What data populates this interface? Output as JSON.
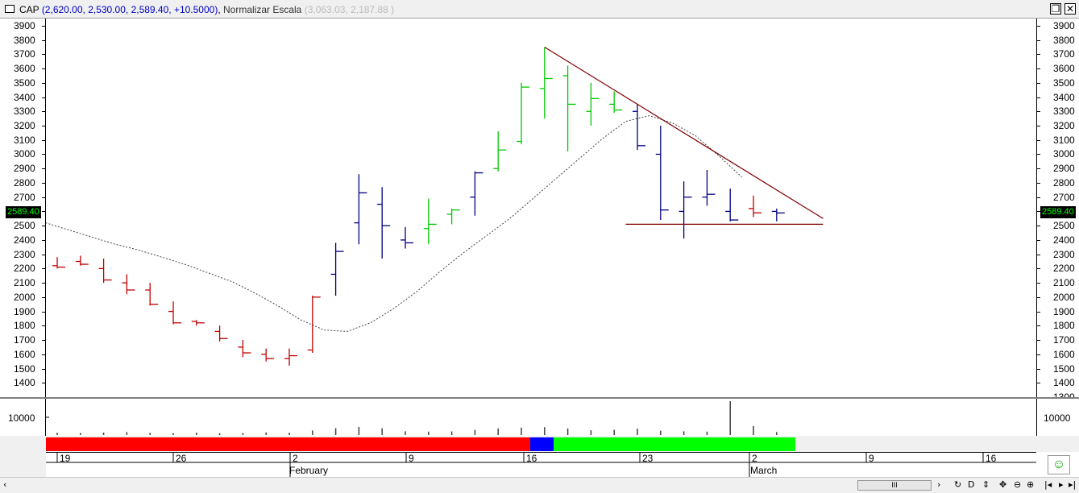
{
  "title": {
    "symbol": "CAP",
    "ohlc": "(2,620.00, 2,530.00, 2,589.40, +10.5000)",
    "normalize_label": "Normalizar Escala",
    "normalize_range": "(3,063.03, 2,187.88 )"
  },
  "window_buttons": {
    "restore": "❐",
    "close": "✕"
  },
  "price_axis": {
    "labels_left": [
      "3900",
      "3800",
      "3700",
      "3600",
      "3500",
      "3400",
      "3300",
      "3200",
      "3100",
      "3000",
      "2900",
      "2800",
      "2700",
      "2600",
      "2500",
      "2400",
      "2300",
      "2200",
      "2100",
      "2000",
      "1900",
      "1800",
      "1700",
      "1600",
      "1500",
      "1400"
    ],
    "labels_right": [
      "3900",
      "3800",
      "3700",
      "3600",
      "3500",
      "3400",
      "3300",
      "3200",
      "3100",
      "3000",
      "2900",
      "2800",
      "2700",
      "2600",
      "2500",
      "2400",
      "2300",
      "2200",
      "2100",
      "2000",
      "1900",
      "1800",
      "1700",
      "1600",
      "1500",
      "1400",
      "1300"
    ],
    "last_price": "2589.40"
  },
  "volume_axis": {
    "label_left": "10000",
    "label_right": "10000"
  },
  "date_axis": {
    "day_labels": [
      "19",
      "26",
      "2",
      "9",
      "16",
      "23",
      "2",
      "9",
      "16"
    ],
    "month_labels": [
      "February",
      "March"
    ]
  },
  "colors": {
    "down": "#c00000",
    "up": "#00c800",
    "neutral": "#000080",
    "trend": "#800000",
    "red_seg": "#ff0000",
    "blue_seg": "#0000ff",
    "green_seg": "#00ff00"
  },
  "chart_data": {
    "type": "ohlc",
    "y_range": [
      1300,
      3950
    ],
    "bars": [
      {
        "x": 0,
        "h": 2280,
        "l": 2200,
        "o": 2220,
        "c": 2210,
        "dir": "down"
      },
      {
        "x": 1,
        "h": 2290,
        "l": 2220,
        "o": 2250,
        "c": 2230,
        "dir": "down"
      },
      {
        "x": 2,
        "h": 2270,
        "l": 2100,
        "o": 2200,
        "c": 2120,
        "dir": "down"
      },
      {
        "x": 3,
        "h": 2160,
        "l": 2020,
        "o": 2100,
        "c": 2050,
        "dir": "down"
      },
      {
        "x": 4,
        "h": 2100,
        "l": 1940,
        "o": 2050,
        "c": 1950,
        "dir": "down"
      },
      {
        "x": 5,
        "h": 1970,
        "l": 1810,
        "o": 1900,
        "c": 1820,
        "dir": "down"
      },
      {
        "x": 6,
        "h": 1840,
        "l": 1800,
        "o": 1830,
        "c": 1820,
        "dir": "down"
      },
      {
        "x": 7,
        "h": 1800,
        "l": 1690,
        "o": 1760,
        "c": 1710,
        "dir": "down"
      },
      {
        "x": 8,
        "h": 1700,
        "l": 1580,
        "o": 1650,
        "c": 1610,
        "dir": "down"
      },
      {
        "x": 9,
        "h": 1640,
        "l": 1550,
        "o": 1600,
        "c": 1570,
        "dir": "down"
      },
      {
        "x": 10,
        "h": 1640,
        "l": 1520,
        "o": 1570,
        "c": 1590,
        "dir": "down"
      },
      {
        "x": 11,
        "h": 2010,
        "l": 1610,
        "o": 1630,
        "c": 2000,
        "dir": "down"
      },
      {
        "x": 12,
        "h": 2380,
        "l": 2010,
        "o": 2160,
        "c": 2320,
        "dir": "neutral"
      },
      {
        "x": 13,
        "h": 2860,
        "l": 2370,
        "o": 2520,
        "c": 2730,
        "dir": "neutral"
      },
      {
        "x": 14,
        "h": 2770,
        "l": 2270,
        "o": 2650,
        "c": 2500,
        "dir": "neutral"
      },
      {
        "x": 15,
        "h": 2490,
        "l": 2340,
        "o": 2400,
        "c": 2380,
        "dir": "neutral"
      },
      {
        "x": 16,
        "h": 2690,
        "l": 2370,
        "o": 2480,
        "c": 2510,
        "dir": "up"
      },
      {
        "x": 17,
        "h": 2620,
        "l": 2510,
        "o": 2580,
        "c": 2610,
        "dir": "up"
      },
      {
        "x": 18,
        "h": 2880,
        "l": 2570,
        "o": 2700,
        "c": 2870,
        "dir": "neutral"
      },
      {
        "x": 19,
        "h": 3160,
        "l": 2880,
        "o": 2900,
        "c": 3030,
        "dir": "up"
      },
      {
        "x": 20,
        "h": 3500,
        "l": 3070,
        "o": 3090,
        "c": 3470,
        "dir": "up"
      },
      {
        "x": 21,
        "h": 3750,
        "l": 3250,
        "o": 3460,
        "c": 3530,
        "dir": "up"
      },
      {
        "x": 22,
        "h": 3620,
        "l": 3020,
        "o": 3550,
        "c": 3350,
        "dir": "up"
      },
      {
        "x": 23,
        "h": 3500,
        "l": 3200,
        "o": 3300,
        "c": 3390,
        "dir": "up"
      },
      {
        "x": 24,
        "h": 3440,
        "l": 3290,
        "o": 3350,
        "c": 3310,
        "dir": "up"
      },
      {
        "x": 25,
        "h": 3350,
        "l": 3030,
        "o": 3300,
        "c": 3060,
        "dir": "neutral"
      },
      {
        "x": 26,
        "h": 3200,
        "l": 2540,
        "o": 3000,
        "c": 2610,
        "dir": "neutral"
      },
      {
        "x": 27,
        "h": 2810,
        "l": 2410,
        "o": 2600,
        "c": 2700,
        "dir": "neutral"
      },
      {
        "x": 28,
        "h": 2890,
        "l": 2640,
        "o": 2700,
        "c": 2720,
        "dir": "neutral"
      },
      {
        "x": 29,
        "h": 2760,
        "l": 2530,
        "o": 2600,
        "c": 2540,
        "dir": "neutral"
      },
      {
        "x": 30,
        "h": 2710,
        "l": 2560,
        "o": 2620,
        "c": 2590,
        "dir": "down"
      },
      {
        "x": 31,
        "h": 2620,
        "l": 2530,
        "o": 2600,
        "c": 2589.4,
        "dir": "neutral"
      }
    ],
    "moving_average": [
      2520,
      2470,
      2420,
      2370,
      2330,
      2280,
      2230,
      2170,
      2110,
      2030,
      1940,
      1840,
      1770,
      1760,
      1820,
      1920,
      2040,
      2180,
      2310,
      2430,
      2550,
      2690,
      2830,
      2970,
      3110,
      3230,
      3270,
      3220,
      3130,
      2990,
      2840
    ],
    "trendlines": [
      {
        "from": [
          21,
          3750
        ],
        "to": [
          33,
          2550
        ]
      },
      {
        "from": [
          24.5,
          2510
        ],
        "to": [
          33,
          2510
        ]
      }
    ],
    "volume": [
      200,
      180,
      220,
      260,
      190,
      170,
      210,
      160,
      180,
      230,
      200,
      400,
      600,
      720,
      600,
      330,
      300,
      320,
      450,
      580,
      650,
      700,
      580,
      420,
      460,
      560,
      380,
      330,
      300,
      3000,
      800,
      260
    ]
  }
}
